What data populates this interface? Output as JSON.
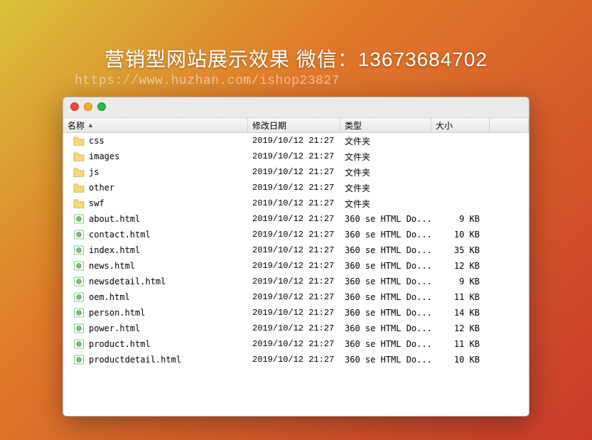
{
  "heading": "营销型网站展示效果 微信：13673684702",
  "suburl": "https://www.huzhan.com/ishop23827",
  "columns": {
    "name": "名称",
    "date": "修改日期",
    "type": "类型",
    "size": "大小"
  },
  "sort_indicator": "▲",
  "rows": [
    {
      "icon": "folder",
      "name": "css",
      "date": "2019/10/12 21:27",
      "type": "文件夹",
      "size": ""
    },
    {
      "icon": "folder",
      "name": "images",
      "date": "2019/10/12 21:27",
      "type": "文件夹",
      "size": ""
    },
    {
      "icon": "folder",
      "name": "js",
      "date": "2019/10/12 21:27",
      "type": "文件夹",
      "size": ""
    },
    {
      "icon": "folder",
      "name": "other",
      "date": "2019/10/12 21:27",
      "type": "文件夹",
      "size": ""
    },
    {
      "icon": "folder",
      "name": "swf",
      "date": "2019/10/12 21:27",
      "type": "文件夹",
      "size": ""
    },
    {
      "icon": "html",
      "name": "about.html",
      "date": "2019/10/12 21:27",
      "type": "360 se HTML Do...",
      "size": "9 KB"
    },
    {
      "icon": "html",
      "name": "contact.html",
      "date": "2019/10/12 21:27",
      "type": "360 se HTML Do...",
      "size": "10 KB"
    },
    {
      "icon": "html",
      "name": "index.html",
      "date": "2019/10/12 21:27",
      "type": "360 se HTML Do...",
      "size": "35 KB"
    },
    {
      "icon": "html",
      "name": "news.html",
      "date": "2019/10/12 21:27",
      "type": "360 se HTML Do...",
      "size": "12 KB"
    },
    {
      "icon": "html",
      "name": "newsdetail.html",
      "date": "2019/10/12 21:27",
      "type": "360 se HTML Do...",
      "size": "9 KB"
    },
    {
      "icon": "html",
      "name": "oem.html",
      "date": "2019/10/12 21:27",
      "type": "360 se HTML Do...",
      "size": "11 KB"
    },
    {
      "icon": "html",
      "name": "person.html",
      "date": "2019/10/12 21:27",
      "type": "360 se HTML Do...",
      "size": "14 KB"
    },
    {
      "icon": "html",
      "name": "power.html",
      "date": "2019/10/12 21:27",
      "type": "360 se HTML Do...",
      "size": "12 KB"
    },
    {
      "icon": "html",
      "name": "product.html",
      "date": "2019/10/12 21:27",
      "type": "360 se HTML Do...",
      "size": "11 KB"
    },
    {
      "icon": "html",
      "name": "productdetail.html",
      "date": "2019/10/12 21:27",
      "type": "360 se HTML Do...",
      "size": "10 KB"
    }
  ]
}
